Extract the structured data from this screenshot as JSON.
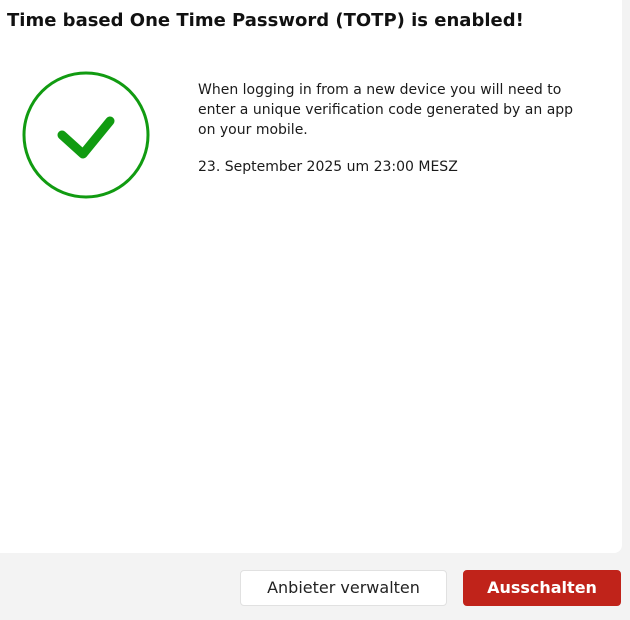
{
  "dialog": {
    "title": "Time based One Time Password (TOTP) is enabled!",
    "status_icon": "check-circle-icon",
    "description": "When logging in from a new device you will need to enter a unique verification code generated by an app on your mobile.",
    "timestamp": "23. September 2025 um 23:00 MESZ"
  },
  "actions": {
    "manage_label": "Anbieter verwalten",
    "disable_label": "Ausschalten"
  },
  "colors": {
    "success": "#119b11",
    "danger": "#c0231a",
    "background": "#f3f3f3",
    "panel": "#ffffff"
  }
}
